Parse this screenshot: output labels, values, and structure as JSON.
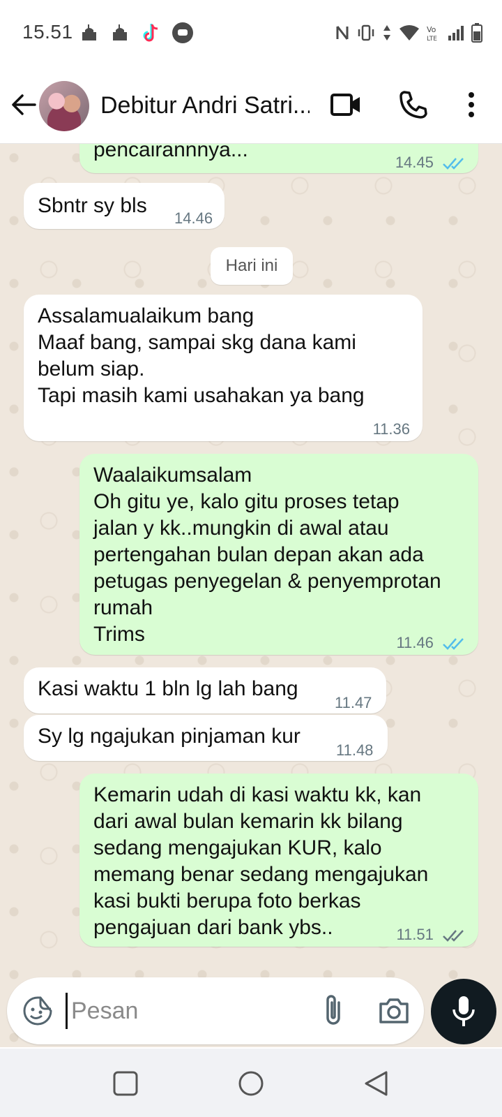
{
  "status_bar": {
    "time": "15.51"
  },
  "header": {
    "contact_name": "Debitur Andri Satri..."
  },
  "chat": {
    "date_chip": "Hari ini",
    "messages": [
      {
        "dir": "out",
        "text": "pencairannnya...",
        "time": "14.45",
        "status": "read"
      },
      {
        "dir": "in",
        "text": "Sbntr sy bls",
        "time": "14.46"
      },
      {
        "dir": "in",
        "text": "Assalamualaikum bang\nMaaf bang, sampai skg dana kami\nbelum siap.\nTapi masih kami usahakan ya bang",
        "time": "11.36"
      },
      {
        "dir": "out",
        "text": "Waalaikumsalam\nOh gitu ye, kalo gitu proses tetap\njalan y kk..mungkin di awal atau\npertengahan bulan depan akan ada\npetugas penyegelan & penyemprotan\nrumah\nTrims",
        "time": "11.46",
        "status": "read"
      },
      {
        "dir": "in",
        "text": "Kasi waktu 1 bln lg lah bang",
        "time": "11.47"
      },
      {
        "dir": "in",
        "text": "Sy lg ngajukan pinjaman kur",
        "time": "11.48"
      },
      {
        "dir": "out",
        "text": "Kemarin udah di kasi waktu kk, kan\ndari awal bulan kemarin kk bilang\nsedang mengajukan KUR, kalo\nmemang benar sedang mengajukan\nkasi bukti berupa foto berkas\npengajuan dari bank ybs..",
        "time": "11.51",
        "status": "delivered"
      }
    ]
  },
  "input": {
    "placeholder": "Pesan",
    "value": ""
  },
  "colors": {
    "outgoing_bubble": "#d9fdd3",
    "incoming_bubble": "#ffffff",
    "read_ticks": "#53bdeb",
    "delivered_ticks": "#667781",
    "chat_bg": "#efe7dd"
  }
}
